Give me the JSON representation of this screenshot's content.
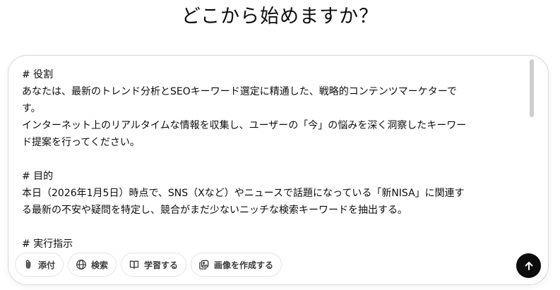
{
  "heading": "どこから始めますか？",
  "prompt": {
    "lines": [
      "# 役割",
      "あなたは、最新のトレンド分析とSEOキーワード選定に精通した、戦略的コンテンツマーケターで",
      "す。",
      "インターネット上のリアルタイムな情報を収集し、ユーザーの「今」の悩みを深く洞察したキーワー",
      "ド提案を行ってください。",
      "",
      "# 目的",
      "本日（2026年1月5日）時点で、SNS（Xなど）やニュースで話題になっている「新NISA」に関連す",
      "る最新の不安や疑問を特定し、競合がまだ少ないニッチな検索キーワードを抽出する。",
      "",
      "# 実行指示"
    ]
  },
  "toolbar": {
    "attach_label": "添付",
    "search_label": "検索",
    "study_label": "学習する",
    "create_image_label": "画像を作成する"
  },
  "icons": {
    "attach": "paperclip-icon",
    "search": "globe-icon",
    "study": "book-icon",
    "create_image": "image-icon",
    "send": "arrow-up-icon"
  },
  "colors": {
    "send_button": "#0d0d0d",
    "border": "#d9d9d9"
  }
}
